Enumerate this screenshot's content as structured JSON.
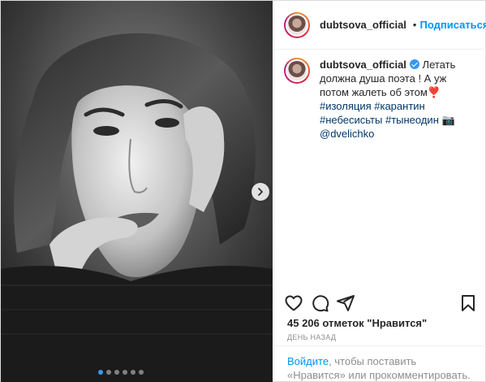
{
  "post": {
    "username": "dubtsova_official",
    "separator": "•",
    "follow_label": "Подписаться",
    "more_icon": "•••",
    "caption": {
      "username": "dubtsova_official",
      "text_before": "Летать должна душа поэта ! А уж потом жалеть об этом",
      "heart_emoji": "❣️",
      "hashtags": [
        "#изоляция",
        "#карантин",
        "#небесисьты",
        "#тынеодин"
      ],
      "camera_emoji": "📷",
      "mention": "@dvelichko"
    },
    "likes_text": "45 206 отметок \"Нравится\"",
    "time_text": "ДЕНЬ НАЗАД",
    "login_link": "Войдите",
    "login_rest": ", чтобы поставить «Нравится» или прокомментировать."
  },
  "carousel": {
    "total": 6,
    "active": 0
  },
  "icons": {
    "like": "heart-icon",
    "comment": "comment-icon",
    "share": "share-icon",
    "save": "bookmark-icon",
    "next": "chevron-right-icon",
    "verified": "verified-badge-icon"
  },
  "colors": {
    "accent": "#0095f6",
    "verified": "#3897f0",
    "text": "#262626",
    "muted": "#8e8e8e",
    "hashtag": "#00376b"
  }
}
